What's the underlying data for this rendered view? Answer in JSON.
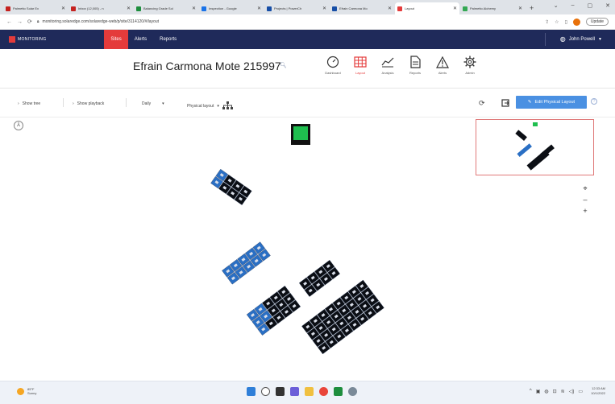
{
  "browser": {
    "tabs": [
      {
        "label": "Palmetto Solar Ex",
        "color": "#c5221f"
      },
      {
        "label": "Inbox (12,005) - n",
        "color": "#c5221f"
      },
      {
        "label": "Balancing Grade Sol",
        "color": "#1e8e3e"
      },
      {
        "label": "Inspection - Google",
        "color": "#1a73e8"
      },
      {
        "label": "Projects | PowerCh",
        "color": "#174ea6"
      },
      {
        "label": "Efrain Carmona Mo",
        "color": "#174ea6"
      },
      {
        "label": "Layout",
        "color": "#e43b3b",
        "active": true
      },
      {
        "label": "Palmetto Alchemy",
        "color": "#34a853"
      }
    ],
    "new_tab": "+",
    "window_controls": [
      "⌄",
      "–",
      "▢",
      "✕"
    ],
    "url": "monitoring.solaredge.com/solaredge-web/p/site/3114120/#/layout",
    "update_label": "Update"
  },
  "app": {
    "logo_text": "MONITORING",
    "menu": [
      "Sites",
      "Alerts",
      "Reports"
    ],
    "user_name": "John Powell"
  },
  "site": {
    "title": "Efrain Carmona Mote 215997"
  },
  "views": [
    {
      "label": "Dashboard",
      "icon": "gauge-icon"
    },
    {
      "label": "Layout",
      "icon": "grid-icon",
      "active": true
    },
    {
      "label": "Analysis",
      "icon": "chart-icon"
    },
    {
      "label": "Reports",
      "icon": "document-icon"
    },
    {
      "label": "Alerts",
      "icon": "warning-icon"
    },
    {
      "label": "Admin",
      "icon": "gear-icon"
    }
  ],
  "toolbar": {
    "show_tree": "Show tree",
    "show_playback": "Show playback",
    "daily": "Daily",
    "layout_mode": "Physical layout",
    "edit_button": "Edit Physical Layout"
  },
  "zoom": [
    "⌖",
    "–",
    "+"
  ],
  "taskbar": {
    "temp": "85°F",
    "weather": "Sunny",
    "time": "12:33 AM",
    "date": "10/1/2022"
  },
  "colors": {
    "header_bg": "#1f2a5a",
    "accent": "#e43b3b",
    "primary_btn": "#4a90e2",
    "panel_dark": "#0b0e14",
    "panel_light": "#2a6fc4",
    "inverter": "#1fbf4f"
  }
}
